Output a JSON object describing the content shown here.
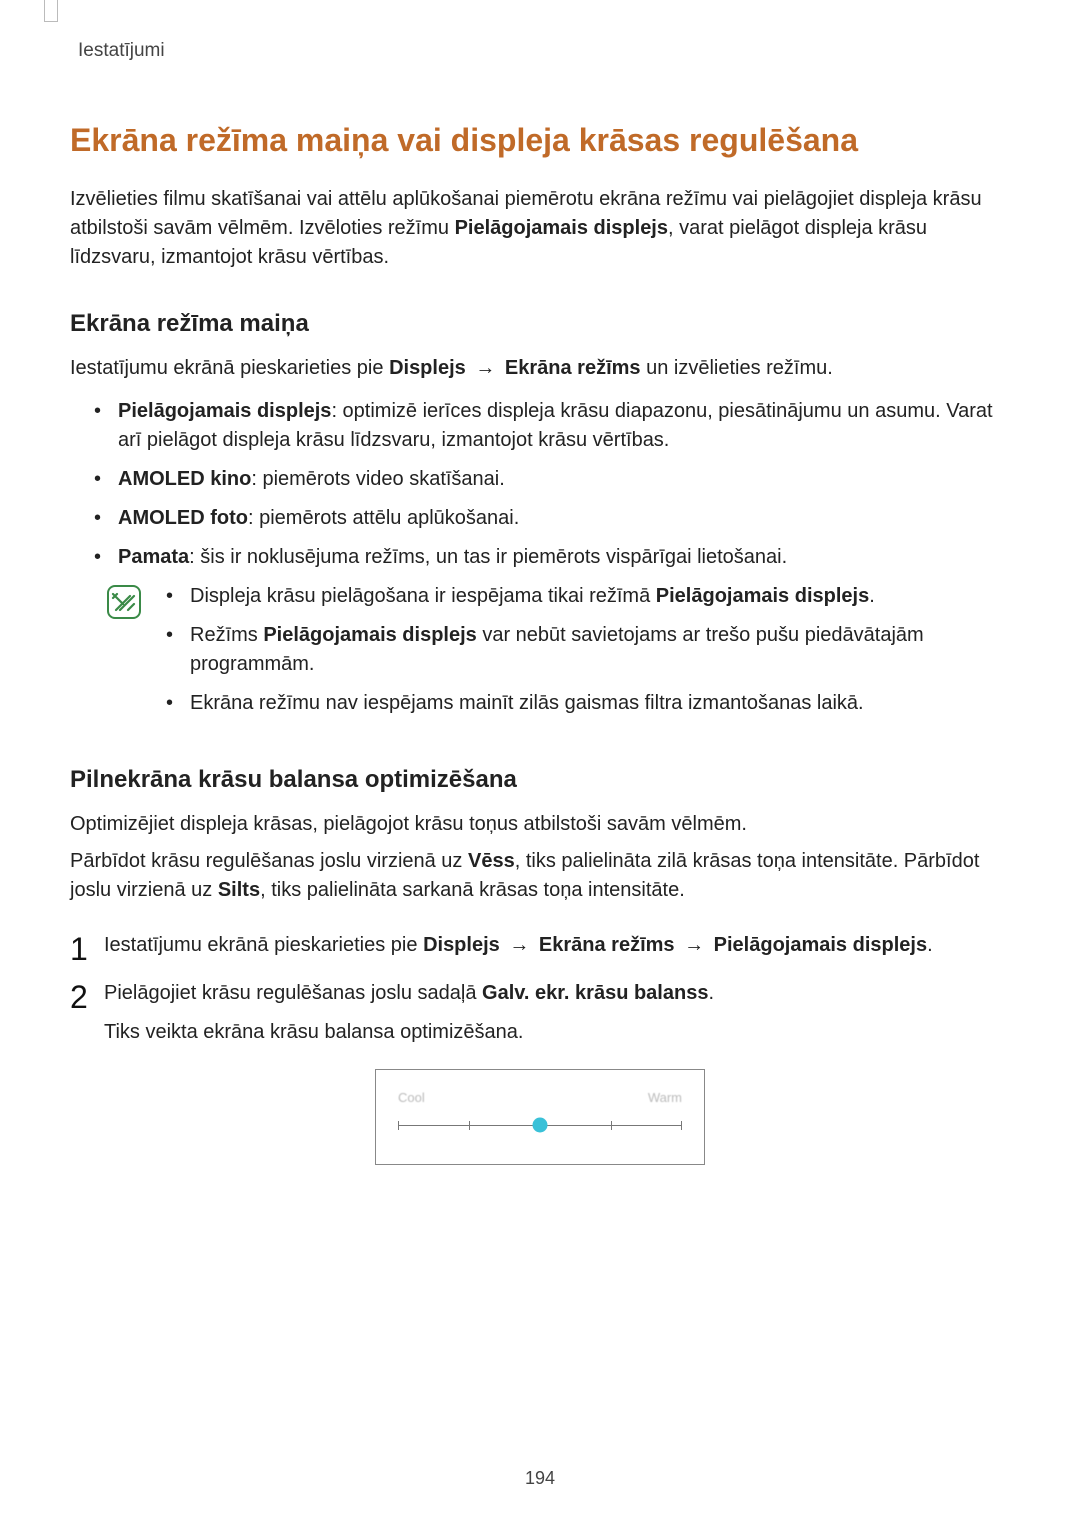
{
  "header": {
    "section": "Iestatījumi"
  },
  "title": "Ekrāna režīma maiņa vai displeja krāsas regulēšana",
  "intro": {
    "pre": "Izvēlieties filmu skatīšanai vai attēlu aplūkošanai piemērotu ekrāna režīmu vai pielāgojiet displeja krāsu atbilstoši savām vēlmēm. Izvēloties režīmu ",
    "bold": "Pielāgojamais displejs",
    "post": ", varat pielāgot displeja krāsu līdzsvaru, izmantojot krāsu vērtības."
  },
  "section1": {
    "heading": "Ekrāna režīma maiņa",
    "lead": {
      "pre": "Iestatījumu ekrānā pieskarieties pie ",
      "b1": "Displejs",
      "arrow": "→",
      "b2": "Ekrāna režīms",
      "post": " un izvēlieties režīmu."
    },
    "modes": [
      {
        "name": "Pielāgojamais displejs",
        "desc": ": optimizē ierīces displeja krāsu diapazonu, piesātinājumu un asumu. Varat arī pielāgot displeja krāsu līdzsvaru, izmantojot krāsu vērtības."
      },
      {
        "name": "AMOLED kino",
        "desc": ": piemērots video skatīšanai."
      },
      {
        "name": "AMOLED foto",
        "desc": ": piemērots attēlu aplūkošanai."
      },
      {
        "name": "Pamata",
        "desc": ": šis ir noklusējuma režīms, un tas ir piemērots vispārīgai lietošanai."
      }
    ],
    "notes": {
      "n1": {
        "pre": "Displeja krāsu pielāgošana ir iespējama tikai režīmā ",
        "bold": "Pielāgojamais displejs",
        "post": "."
      },
      "n2": {
        "pre": "Režīms ",
        "bold": "Pielāgojamais displejs",
        "post": " var nebūt savietojams ar trešo pušu piedāvātajām programmām."
      },
      "n3": "Ekrāna režīmu nav iespējams mainīt zilās gaismas filtra izmantošanas laikā."
    }
  },
  "section2": {
    "heading": "Pilnekrāna krāsu balansa optimizēšana",
    "p1": "Optimizējiet displeja krāsas, pielāgojot krāsu toņus atbilstoši savām vēlmēm.",
    "p2": {
      "pre": "Pārbīdot krāsu regulēšanas joslu virzienā uz ",
      "b1": "Vēss",
      "mid": ", tiks palielināta zilā krāsas toņa intensitāte. Pārbīdot joslu virzienā uz ",
      "b2": "Silts",
      "post": ", tiks palielināta sarkanā krāsas toņa intensitāte."
    },
    "steps": {
      "s1": {
        "num": "1",
        "pre": "Iestatījumu ekrānā pieskarieties pie ",
        "b1": "Displejs",
        "arrow": "→",
        "b2": "Ekrāna režīms",
        "b3": "Pielāgojamais displejs",
        "post": "."
      },
      "s2": {
        "num": "2",
        "pre": "Pielāgojiet krāsu regulēšanas joslu sadaļā ",
        "bold": "Galv. ekr. krāsu balanss",
        "post": ".",
        "sub": "Tiks veikta ekrāna krāsu balansa optimizēšana."
      }
    },
    "slider": {
      "left": "Cool",
      "right": "Warm"
    }
  },
  "page_number": "194"
}
